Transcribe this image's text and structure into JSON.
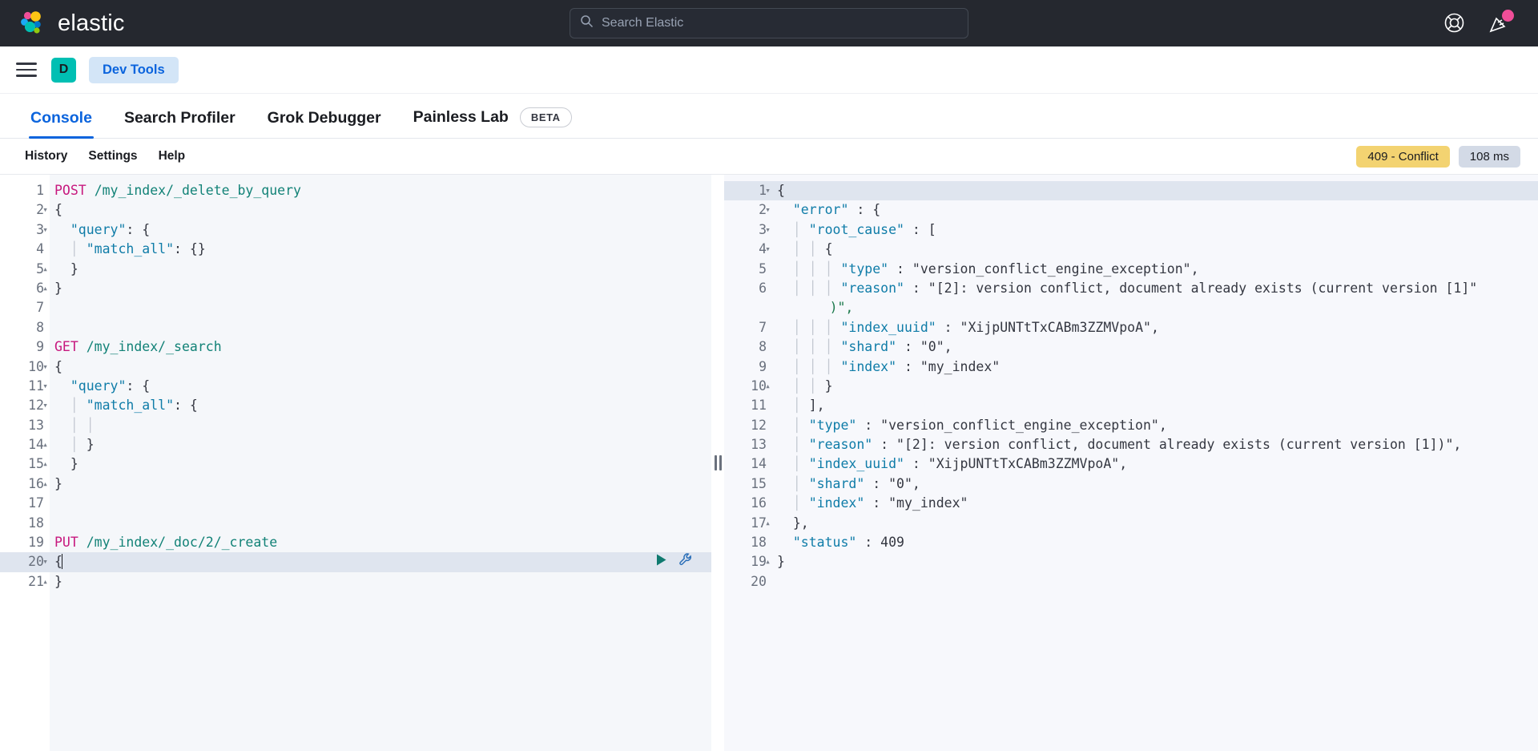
{
  "topbar": {
    "brand_name": "elastic",
    "search": {
      "placeholder": "Search Elastic",
      "value": ""
    },
    "icons": [
      {
        "name": "help-lifebuoy-icon",
        "label": "Help"
      },
      {
        "name": "announcements-icon",
        "label": "What's new"
      }
    ]
  },
  "appbar": {
    "menu_label": "Toggle navigation",
    "avatar_initial": "D",
    "breadcrumb": "Dev Tools"
  },
  "tabs": [
    {
      "label": "Console",
      "active": true,
      "badge": ""
    },
    {
      "label": "Search Profiler",
      "active": false,
      "badge": ""
    },
    {
      "label": "Grok Debugger",
      "active": false,
      "badge": ""
    },
    {
      "label": "Painless Lab",
      "active": false,
      "badge": "BETA"
    }
  ],
  "console_toolbar": {
    "links": [
      "History",
      "Settings",
      "Help"
    ],
    "status_badge": "409 - Conflict",
    "time_badge": "108 ms"
  },
  "colors": {
    "accent_blue": "#0b64dd",
    "teal": "#00bfb3",
    "pink_dot": "#f04e98",
    "status_yellow": "#f3d371",
    "time_gray": "#d3dae6",
    "dark_header": "#25282f"
  },
  "request_editor": {
    "active_line": 20,
    "lines": [
      {
        "n": 1,
        "fold": "",
        "text": "POST /my_index/_delete_by_query"
      },
      {
        "n": 2,
        "fold": "▾",
        "text": "{"
      },
      {
        "n": 3,
        "fold": "▾",
        "text": "  \"query\": {"
      },
      {
        "n": 4,
        "fold": "",
        "text": "    \"match_all\": {}"
      },
      {
        "n": 5,
        "fold": "▴",
        "text": "  }"
      },
      {
        "n": 6,
        "fold": "▴",
        "text": "}"
      },
      {
        "n": 7,
        "fold": "",
        "text": ""
      },
      {
        "n": 8,
        "fold": "",
        "text": ""
      },
      {
        "n": 9,
        "fold": "",
        "text": "GET /my_index/_search"
      },
      {
        "n": 10,
        "fold": "▾",
        "text": "{"
      },
      {
        "n": 11,
        "fold": "▾",
        "text": "  \"query\": {"
      },
      {
        "n": 12,
        "fold": "▾",
        "text": "    \"match_all\": {"
      },
      {
        "n": 13,
        "fold": "",
        "text": "      "
      },
      {
        "n": 14,
        "fold": "▴",
        "text": "    }"
      },
      {
        "n": 15,
        "fold": "▴",
        "text": "  }"
      },
      {
        "n": 16,
        "fold": "▴",
        "text": "}"
      },
      {
        "n": 17,
        "fold": "",
        "text": ""
      },
      {
        "n": 18,
        "fold": "",
        "text": ""
      },
      {
        "n": 19,
        "fold": "",
        "text": "PUT /my_index/_doc/2/_create"
      },
      {
        "n": 20,
        "fold": "▾",
        "text": "{"
      },
      {
        "n": 21,
        "fold": "▴",
        "text": "}"
      }
    ],
    "actions": {
      "play": "send-request",
      "wrench": "request-options"
    }
  },
  "response_editor": {
    "active_line": 1,
    "lines": [
      {
        "n": 1,
        "fold": "▾",
        "text": "{"
      },
      {
        "n": 2,
        "fold": "▾",
        "text": "  \"error\" : {"
      },
      {
        "n": 3,
        "fold": "▾",
        "text": "    \"root_cause\" : ["
      },
      {
        "n": 4,
        "fold": "▾",
        "text": "      {"
      },
      {
        "n": 5,
        "fold": "",
        "text": "        \"type\" : \"version_conflict_engine_exception\","
      },
      {
        "n": 6,
        "fold": "",
        "text": "        \"reason\" : \"[2]: version conflict, document already exists (current version [1])\","
      },
      {
        "n": 7,
        "fold": "",
        "text": "        \"index_uuid\" : \"XijpUNTtTxCABm3ZZMVpoA\","
      },
      {
        "n": 8,
        "fold": "",
        "text": "        \"shard\" : \"0\","
      },
      {
        "n": 9,
        "fold": "",
        "text": "        \"index\" : \"my_index\""
      },
      {
        "n": 10,
        "fold": "▴",
        "text": "      }"
      },
      {
        "n": 11,
        "fold": "",
        "text": "    ],"
      },
      {
        "n": 12,
        "fold": "",
        "text": "    \"type\" : \"version_conflict_engine_exception\","
      },
      {
        "n": 13,
        "fold": "",
        "text": "    \"reason\" : \"[2]: version conflict, document already exists (current version [1])\","
      },
      {
        "n": 14,
        "fold": "",
        "text": "    \"index_uuid\" : \"XijpUNTtTxCABm3ZZMVpoA\","
      },
      {
        "n": 15,
        "fold": "",
        "text": "    \"shard\" : \"0\","
      },
      {
        "n": 16,
        "fold": "",
        "text": "    \"index\" : \"my_index\""
      },
      {
        "n": 17,
        "fold": "▴",
        "text": "  },"
      },
      {
        "n": 18,
        "fold": "",
        "text": "  \"status\" : 409"
      },
      {
        "n": 19,
        "fold": "▴",
        "text": "}"
      },
      {
        "n": 20,
        "fold": "",
        "text": ""
      }
    ]
  }
}
